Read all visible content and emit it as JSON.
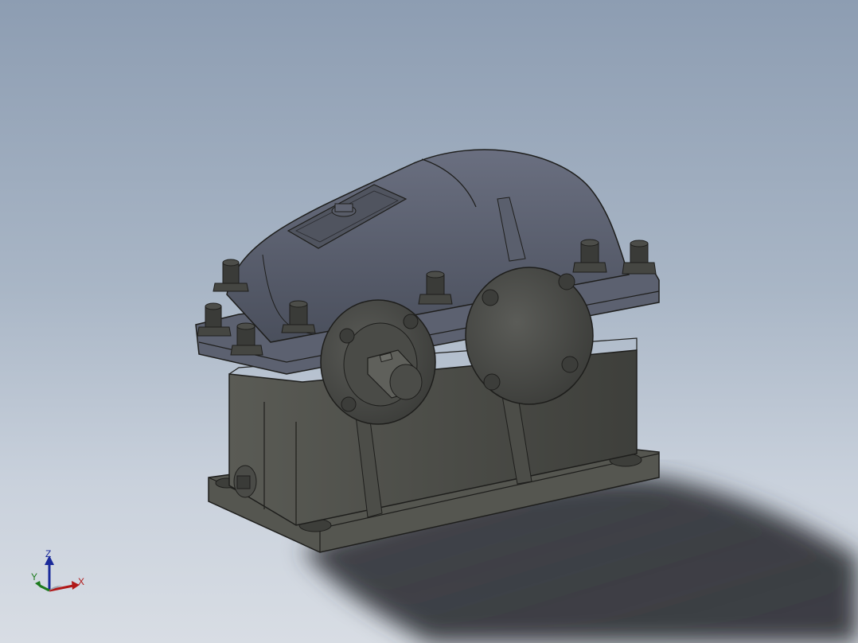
{
  "viewport": {
    "background_top": "#8d9db2",
    "background_bottom": "#d8dde4"
  },
  "model": {
    "housing_color": "#4e4f4a",
    "cover_color": "#555a68",
    "shadow_color": "#2e3036"
  },
  "triad": {
    "x_label": "X",
    "y_label": "Y",
    "z_label": "Z",
    "x_color": "#b01818",
    "y_color": "#1c7a1c",
    "z_color": "#1a2a9a"
  }
}
